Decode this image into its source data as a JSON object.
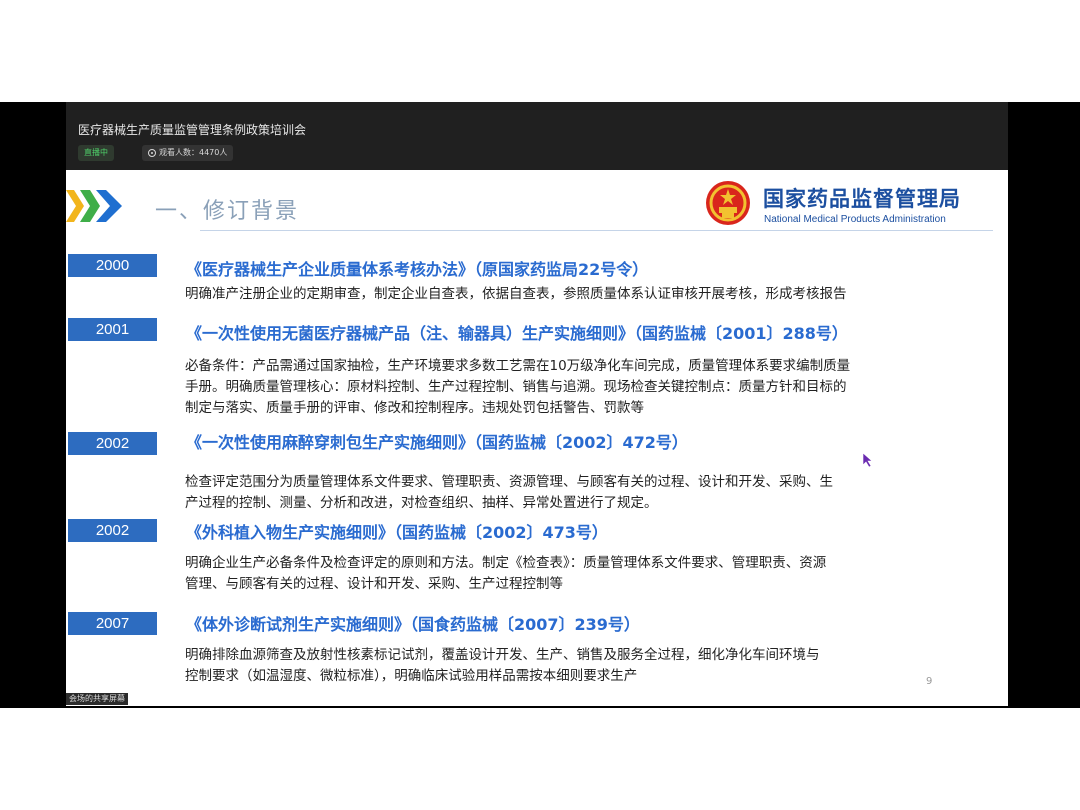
{
  "stream": {
    "title": "医疗器械生产质量监管管理条例政策培训会",
    "live_label": "直播中",
    "viewers_label": "观看人数：4470人"
  },
  "slide": {
    "section_title": "一、修订背景",
    "agency_cn": "国家药品监督管理局",
    "agency_en": "National Medical Products Administration",
    "entries": [
      {
        "year": "2000",
        "doc": "《医疗器械生产企业质量体系考核办法》（原国家药监局22号令）",
        "lines": [
          "明确准产注册企业的定期审查，制定企业自查表，依据自查表，参照质量体系认证审核开展考核，形成考核报告"
        ]
      },
      {
        "year": "2001",
        "doc": "《一次性使用无菌医疗器械产品（注、输器具）生产实施细则》（国药监械〔2001〕288号）",
        "lines": [
          "必备条件：产品需通过国家抽检，生产环境要求多数工艺需在10万级净化车间完成，质量管理体系要求编制质量",
          "手册。明确质量管理核心：原材料控制、生产过程控制、销售与追溯。现场检查关键控制点：质量方针和目标的",
          "制定与落实、质量手册的评审、修改和控制程序。违规处罚包括警告、罚款等"
        ]
      },
      {
        "year": "2002",
        "doc": "《一次性使用麻醉穿刺包生产实施细则》（国药监械〔2002〕472号）",
        "lines": [
          "检查评定范围分为质量管理体系文件要求、管理职责、资源管理、与顾客有关的过程、设计和开发、采购、生",
          "产过程的控制、测量、分析和改进，对检查组织、抽样、异常处置进行了规定。"
        ]
      },
      {
        "year": "2002",
        "doc": "《外科植入物生产实施细则》（国药监械〔2002〕473号）",
        "lines": [
          "明确企业生产必备条件及检查评定的原则和方法。制定《检查表》：质量管理体系文件要求、管理职责、资源",
          "管理、与顾客有关的过程、设计和开发、采购、生产过程控制等"
        ]
      },
      {
        "year": "2007",
        "doc": "《体外诊断试剂生产实施细则》（国食药监械〔2007〕239号）",
        "lines": [
          "明确排除血源筛查及放射性核素标记试剂，覆盖设计开发、生产、销售及服务全过程，细化净化车间环境与",
          "控制要求（如温湿度、微粒标准），明确临床试验用样品需按本细则要求生产"
        ]
      }
    ],
    "page_number": "9"
  },
  "share_label": "会场的共享屏幕",
  "colors": {
    "accent_blue": "#2d6cc0",
    "doc_blue": "#2a6bd0",
    "agency_blue": "#1c4fa0",
    "chevron_yellow": "#f2b51c",
    "chevron_green": "#3fae49",
    "chevron_blue": "#1f6fd0"
  }
}
